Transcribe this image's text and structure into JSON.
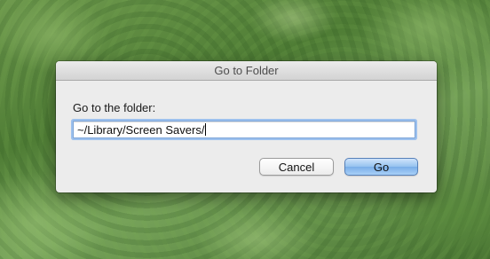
{
  "dialog": {
    "title": "Go to Folder",
    "prompt": "Go to the folder:",
    "path_value": "~/Library/Screen Savers/",
    "cancel_label": "Cancel",
    "go_label": "Go"
  },
  "colors": {
    "dialog_bg": "#ececec",
    "focus_ring": "#9dc1ee",
    "default_button": "#79aee8"
  }
}
